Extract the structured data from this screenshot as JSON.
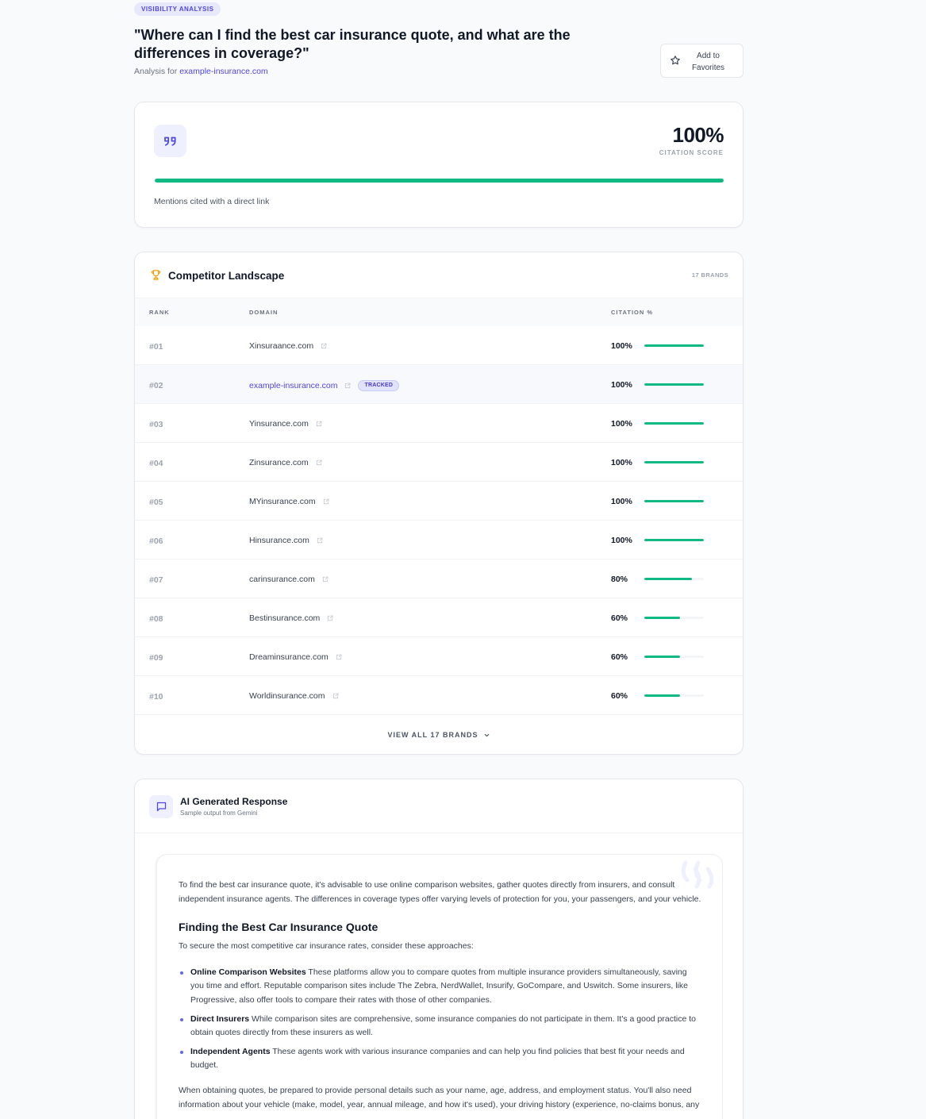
{
  "header": {
    "badge": "VISIBILITY ANALYSIS",
    "title": "\"Where can I find the best car insurance quote, and what are the differences in coverage?\"",
    "analysis_prefix": "Analysis for",
    "analysis_domain": "example-insurance.com",
    "favorite_label": "Add to Favorites"
  },
  "score": {
    "value": "100%",
    "label": "CITATION SCORE",
    "percent": 100,
    "note": "Mentions cited with a direct link"
  },
  "competitors": {
    "title": "Competitor Landscape",
    "count_label": "17 BRANDS",
    "columns": {
      "rank": "RANK",
      "domain": "DOMAIN",
      "citation": "CITATION %"
    },
    "tracked_tag": "TRACKED",
    "rows": [
      {
        "rank": "#01",
        "domain": "Xinsuraance.com",
        "pct": "100%",
        "value": 100,
        "tracked": false
      },
      {
        "rank": "#02",
        "domain": "example-insurance.com",
        "pct": "100%",
        "value": 100,
        "tracked": true
      },
      {
        "rank": "#03",
        "domain": "Yinsurance.com",
        "pct": "100%",
        "value": 100,
        "tracked": false
      },
      {
        "rank": "#04",
        "domain": "Zinsurance.com",
        "pct": "100%",
        "value": 100,
        "tracked": false
      },
      {
        "rank": "#05",
        "domain": "MYinsurance.com",
        "pct": "100%",
        "value": 100,
        "tracked": false
      },
      {
        "rank": "#06",
        "domain": "Hinsurance.com",
        "pct": "100%",
        "value": 100,
        "tracked": false
      },
      {
        "rank": "#07",
        "domain": "carinsurance.com",
        "pct": "80%",
        "value": 80,
        "tracked": false
      },
      {
        "rank": "#08",
        "domain": "Bestinsurance.com",
        "pct": "60%",
        "value": 60,
        "tracked": false
      },
      {
        "rank": "#09",
        "domain": "Dreaminsurance.com",
        "pct": "60%",
        "value": 60,
        "tracked": false
      },
      {
        "rank": "#10",
        "domain": "Worldinsurance.com",
        "pct": "60%",
        "value": 60,
        "tracked": false
      }
    ],
    "view_all": "VIEW ALL 17 BRANDS"
  },
  "ai_response": {
    "title": "AI Generated Response",
    "subtitle": "Sample output from Gemini",
    "intro": "To find the best car insurance quote, it's advisable to use online comparison websites, gather quotes directly from insurers, and consult independent insurance agents. The differences in coverage types offer varying levels of protection for you, your passengers, and your vehicle.",
    "heading": "Finding the Best Car Insurance Quote",
    "lead": "To secure the most competitive car insurance rates, consider these approaches:",
    "items": [
      {
        "term": "Online Comparison Websites",
        "text": "These platforms allow you to compare quotes from multiple insurance providers simultaneously, saving you time and effort. Reputable comparison sites include The Zebra, NerdWallet, Insurify, GoCompare, and Uswitch. Some insurers, like Progressive, also offer tools to compare their rates with those of other companies."
      },
      {
        "term": "Direct Insurers",
        "text": "While comparison sites are comprehensive, some insurance companies do not participate in them. It's a good practice to obtain quotes directly from these insurers as well."
      },
      {
        "term": "Independent Agents",
        "text": "These agents work with various insurance companies and can help you find policies that best fit your needs and budget."
      }
    ],
    "closing": "When obtaining quotes, be prepared to provide personal details such as your name, age, address, and employment status. You'll also need information about your vehicle (make, model, year, annual mileage, and how it's used), your driving history (experience, no-claims bonus, any"
  },
  "colors": {
    "accent": "#4f46e5",
    "bar": "#10b981",
    "trophy": "#f59e0b"
  },
  "icons": {
    "favorite": "star-icon",
    "score": "quote-icon",
    "competitors": "trophy-icon",
    "external": "external-link-icon",
    "expand": "chevron-down-icon",
    "ai": "chat-bubble-icon"
  }
}
